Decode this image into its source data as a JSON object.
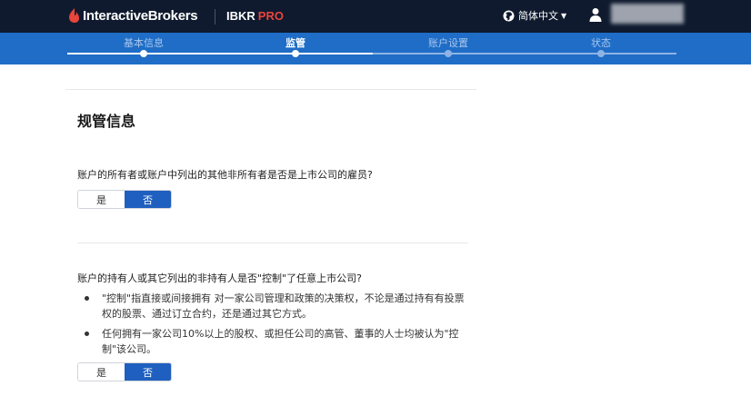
{
  "header": {
    "brand_name": "InteractiveBrokers",
    "product_name": "IBKR",
    "product_badge": "PRO",
    "language": "简体中文",
    "brand_color": "#e8453c"
  },
  "steps": [
    {
      "label": "基本信息",
      "status": "done"
    },
    {
      "label": "监管",
      "status": "current"
    },
    {
      "label": "账户设置",
      "status": "todo"
    },
    {
      "label": "状态",
      "status": "todo"
    }
  ],
  "page": {
    "title": "规管信息"
  },
  "q1": {
    "text": "账户的所有者或账户中列出的其他非所有者是否是上市公司的雇员?",
    "yes": "是",
    "no": "否",
    "selected": "no"
  },
  "q2": {
    "text": "账户的持有人或其它列出的非持有人是否\"控制\"了任意上市公司?",
    "bullets": [
      "\"控制\"指直接或间接拥有 对一家公司管理和政策的决策权，不论是通过持有有投票权的股票、通过订立合约，还是通过其它方式。",
      "任何拥有一家公司10%以上的股权、或担任公司的高管、董事的人士均被认为\"控制\"该公司。"
    ],
    "yes": "是",
    "no": "否",
    "selected": "no"
  },
  "colors": {
    "topbar": "#0f1a2e",
    "stepbar": "#1f6dc6",
    "selected_toggle": "#1f5fbf"
  }
}
